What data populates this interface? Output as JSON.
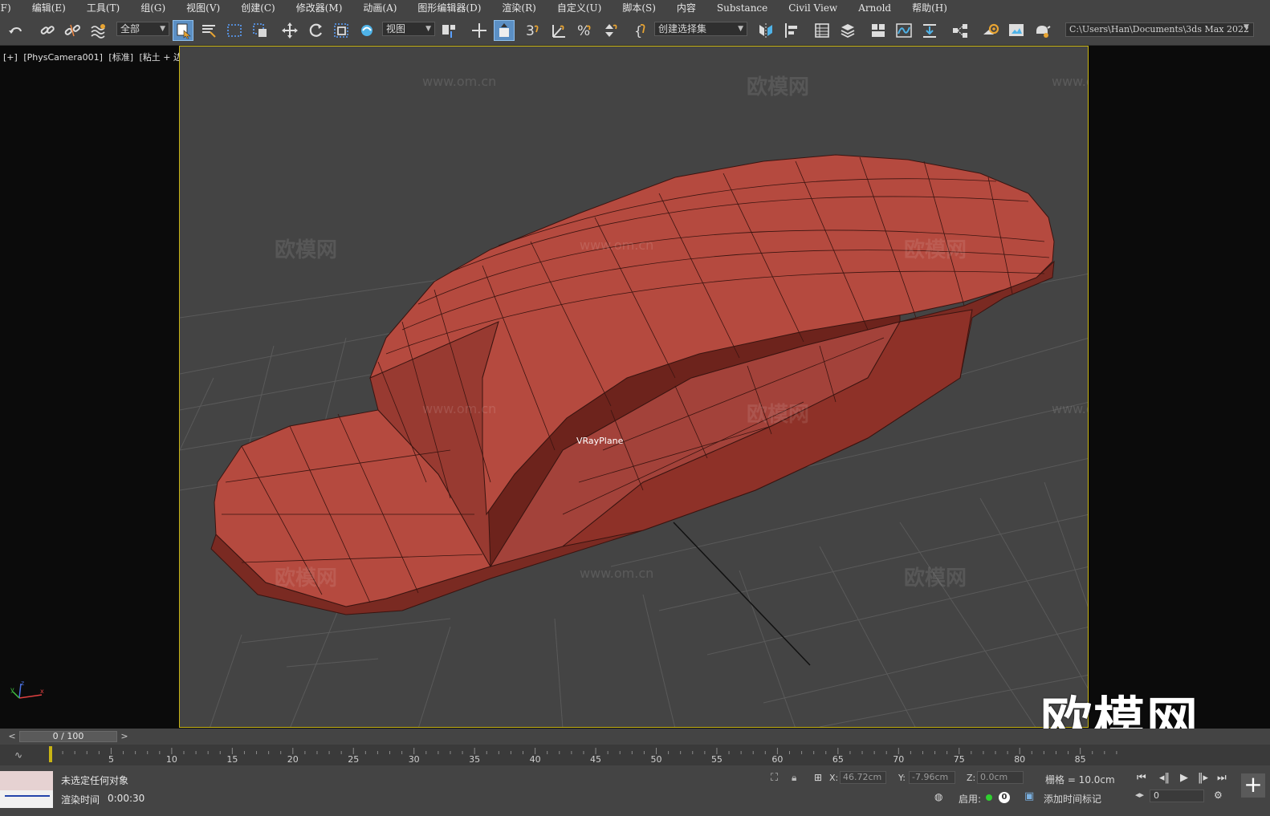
{
  "menu": {
    "items": [
      "(F)",
      "编辑(E)",
      "工具(T)",
      "组(G)",
      "视图(V)",
      "创建(C)",
      "修改器(M)",
      "动画(A)",
      "图形编辑器(D)",
      "渲染(R)",
      "自定义(U)",
      "脚本(S)",
      "内容",
      "Substance",
      "Civil View",
      "Arnold",
      "帮助(H)"
    ]
  },
  "toolbar": {
    "filter_dropdown": "全部",
    "refcoord_dropdown": "视图",
    "selection_set_dropdown": "创建选择集",
    "project_path": "C:\\Users\\Han\\Documents\\3ds Max 2022",
    "icons": [
      "undo-icon",
      "link-icon",
      "unlink-icon",
      "bind-spacewarp-icon",
      "select-object-icon",
      "select-by-name-icon",
      "rect-selection-icon",
      "window-crossing-icon",
      "move-icon",
      "rotate-icon",
      "scale-icon",
      "select-manipulate-icon",
      "pivot-icon",
      "keyboard-shortcut-icon",
      "snap-toggle-icon",
      "angle-snap-icon",
      "percent-snap-icon",
      "spinner-snap-icon",
      "named-selection-icon",
      "mirror-icon",
      "align-icon",
      "scene-explorer-icon",
      "layer-explorer-icon",
      "toggle-ribbon-icon",
      "curve-editor-icon",
      "dopesheet-icon",
      "schematic-view-icon",
      "material-editor-icon",
      "render-setup-icon",
      "rendered-frame-icon",
      "render-icon"
    ]
  },
  "viewport": {
    "label_parts": [
      "[+]",
      "[PhysCamera001]",
      "[标准]",
      "[粘土 + 边面]"
    ],
    "object_label": "VRayPlane",
    "object_color": "#b54a3f",
    "edge_color": "#3a1410",
    "bg_color": "#444444",
    "watermark_text": "欧模网",
    "watermark_url": "www.om.cn",
    "big_logo": "欧模网"
  },
  "timeline": {
    "slider_text": "0 / 100",
    "prev_label": "<",
    "next_label": ">",
    "ticks": [
      "5",
      "10",
      "15",
      "20",
      "25",
      "30",
      "35",
      "40",
      "45",
      "50",
      "55",
      "60",
      "65",
      "70",
      "75",
      "80",
      "85"
    ],
    "current_frame": 0,
    "total_frames": 100
  },
  "status": {
    "message": "未选定任何对象",
    "render_time_label": "渲染时间",
    "render_time_value": "0:00:30",
    "x_label": "X:",
    "x_value": "46.72cm",
    "y_label": "Y:",
    "y_value": "-7.96cm",
    "z_label": "Z:",
    "z_value": "0.0cm",
    "grid": "栅格 = 10.0cm",
    "enable_label": "启用:",
    "enable_count": "0",
    "add_time_tag": "添加时间标记",
    "frame_value": "0"
  }
}
